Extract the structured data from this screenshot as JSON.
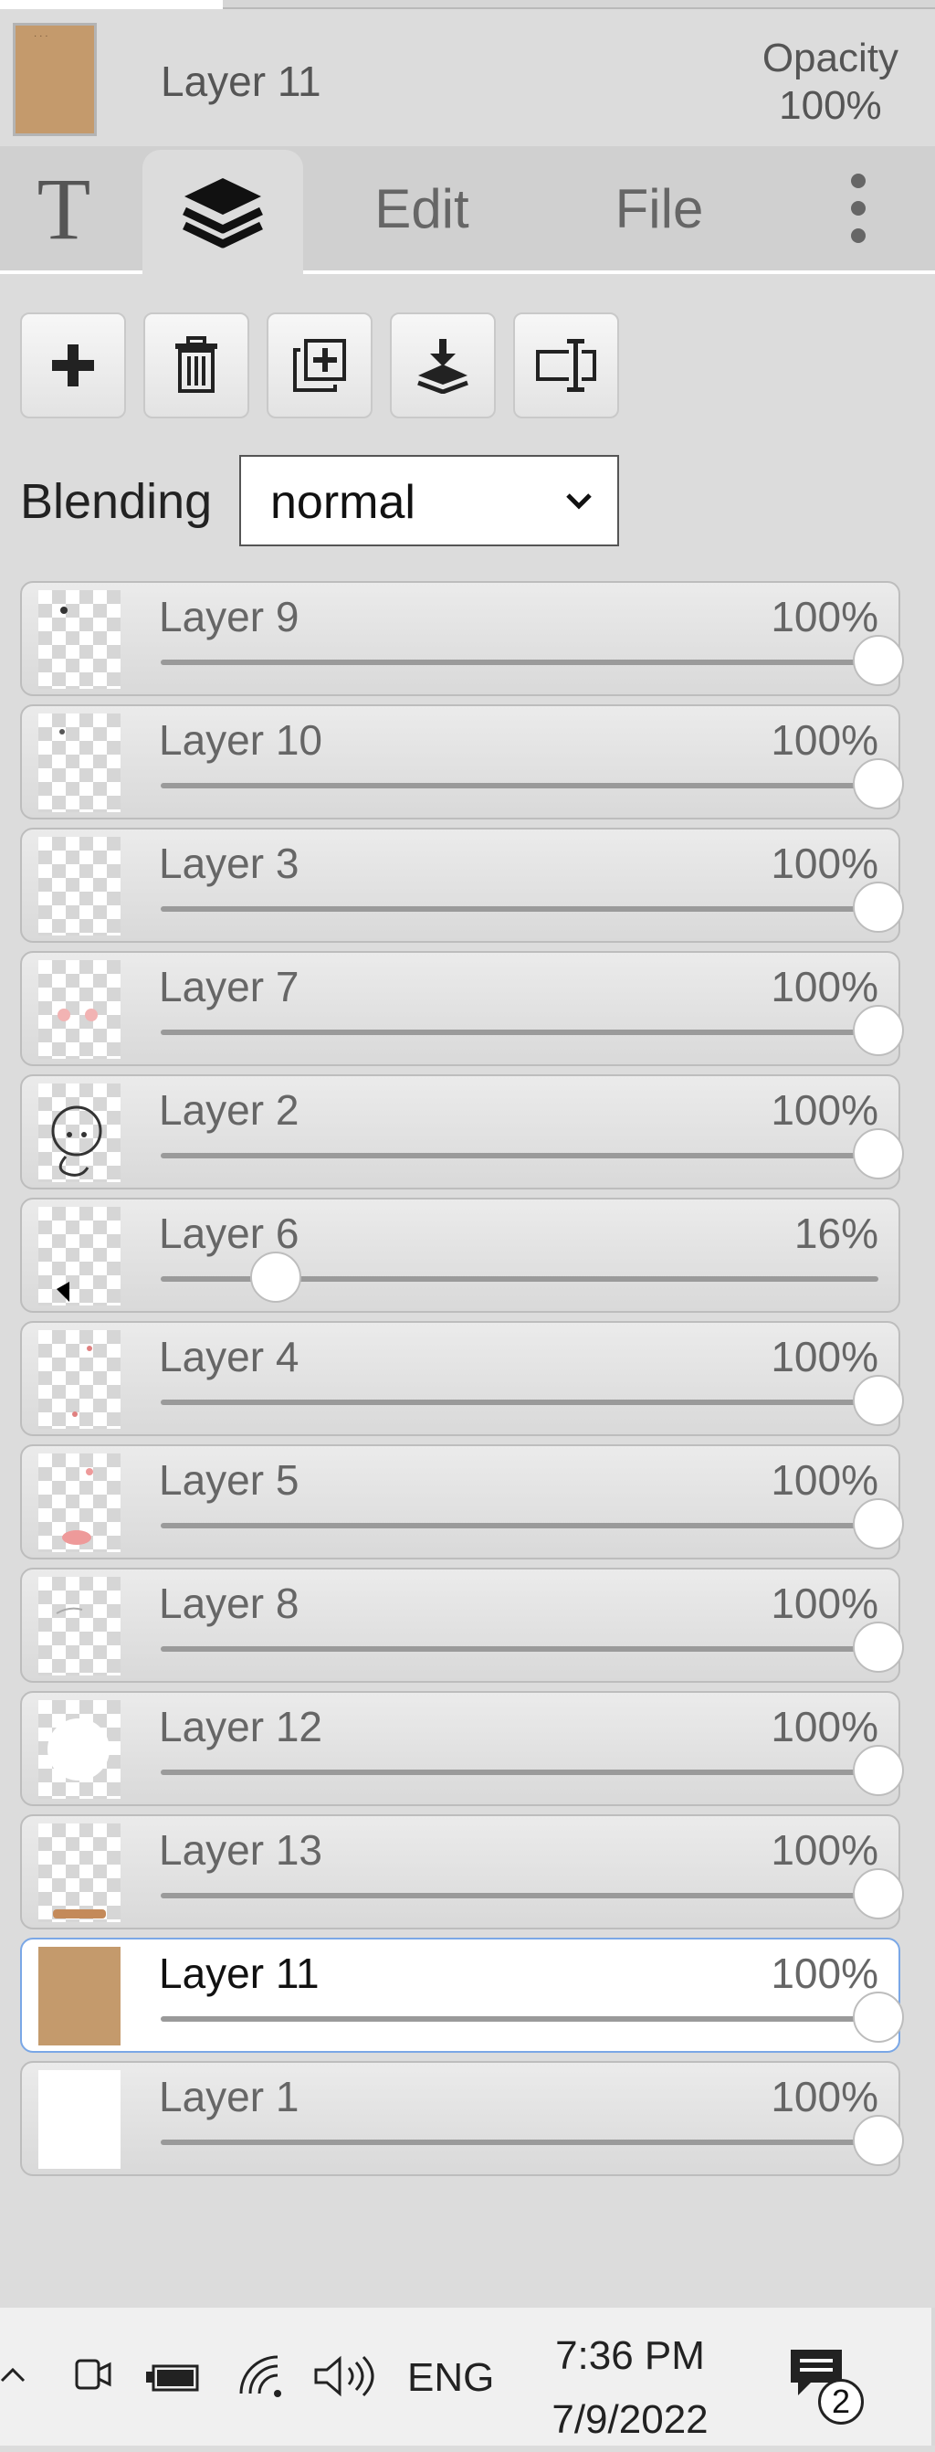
{
  "header": {
    "layer_name": "Layer 11",
    "opacity_label": "Opacity",
    "opacity_value": "100%"
  },
  "tabs": {
    "text_tab": "T",
    "layers_icon": "layers-icon",
    "edit": "Edit",
    "file": "File",
    "more_icon": "more-vertical-icon"
  },
  "toolbar": {
    "buttons": [
      "add-layer-icon",
      "delete-layer-icon",
      "duplicate-layer-icon",
      "merge-down-icon",
      "rename-layer-icon"
    ]
  },
  "blending": {
    "label": "Blending",
    "value": "normal"
  },
  "layers": [
    {
      "name": "Layer 9",
      "opacity": "100%",
      "opacity_value": 1.0,
      "active": false
    },
    {
      "name": "Layer 10",
      "opacity": "100%",
      "opacity_value": 1.0,
      "active": false
    },
    {
      "name": "Layer 3",
      "opacity": "100%",
      "opacity_value": 1.0,
      "active": false
    },
    {
      "name": "Layer 7",
      "opacity": "100%",
      "opacity_value": 1.0,
      "active": false
    },
    {
      "name": "Layer 2",
      "opacity": "100%",
      "opacity_value": 1.0,
      "active": false
    },
    {
      "name": "Layer 6",
      "opacity": "16%",
      "opacity_value": 0.16,
      "active": false
    },
    {
      "name": "Layer 4",
      "opacity": "100%",
      "opacity_value": 1.0,
      "active": false
    },
    {
      "name": "Layer 5",
      "opacity": "100%",
      "opacity_value": 1.0,
      "active": false
    },
    {
      "name": "Layer 8",
      "opacity": "100%",
      "opacity_value": 1.0,
      "active": false
    },
    {
      "name": "Layer 12",
      "opacity": "100%",
      "opacity_value": 1.0,
      "active": false
    },
    {
      "name": "Layer 13",
      "opacity": "100%",
      "opacity_value": 1.0,
      "active": false
    },
    {
      "name": "Layer 11",
      "opacity": "100%",
      "opacity_value": 1.0,
      "active": true
    },
    {
      "name": "Layer 1",
      "opacity": "100%",
      "opacity_value": 1.0,
      "active": false
    }
  ],
  "taskbar": {
    "language": "ENG",
    "time": "7:36 PM",
    "date": "7/9/2022",
    "notification_count": "2"
  },
  "colors": {
    "panel_bg": "#dcdcdc",
    "active_border": "#7aa7e6",
    "thumb_brown": "#c49a6c"
  }
}
